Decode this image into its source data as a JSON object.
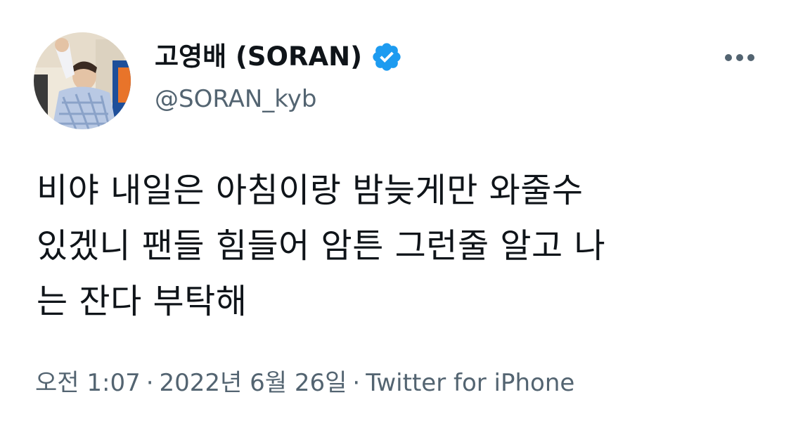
{
  "tweet": {
    "author": {
      "display_name": "고영배 (SORAN)",
      "handle": "@SORAN_kyb",
      "verified": true
    },
    "text": "비야 내일은 아침이랑 밤늦게만 와줄수\n있겠니 팬들 힘들어 암튼 그런줄 알고 나\n는 잔다 부탁해",
    "time": "오전 1:07",
    "date": "2022년 6월 26일",
    "separator": "·",
    "source": "Twitter for iPhone"
  },
  "colors": {
    "text": "#0f1419",
    "secondary": "#536471",
    "verified": "#1d9bf0",
    "background": "#ffffff"
  },
  "icons": {
    "verified": "verified-badge-icon",
    "more": "more-options-icon"
  }
}
